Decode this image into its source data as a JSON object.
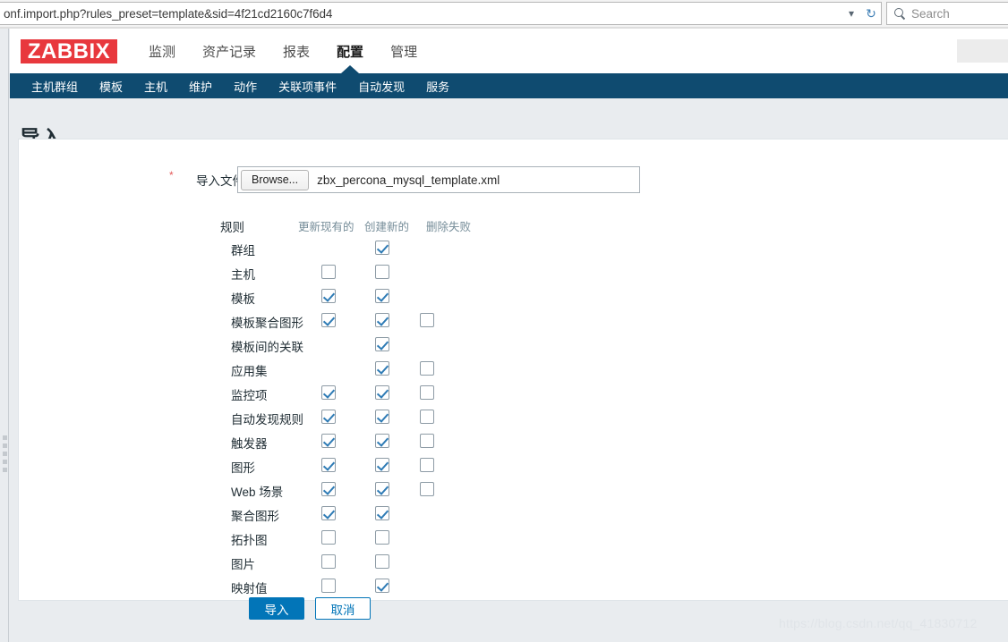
{
  "browser": {
    "url": "onf.import.php?rules_preset=template&sid=4f21cd2160c7f6d4",
    "dropdown_icon": "chevron-down-icon",
    "reload_icon": "reload-icon",
    "search_icon": "search-icon",
    "search_placeholder": "Search",
    "search_value": ""
  },
  "header": {
    "logo": "ZABBIX",
    "nav": [
      {
        "label": "监测",
        "active": false
      },
      {
        "label": "资产记录",
        "active": false
      },
      {
        "label": "报表",
        "active": false
      },
      {
        "label": "配置",
        "active": true
      },
      {
        "label": "管理",
        "active": false
      }
    ]
  },
  "subnav": {
    "items": [
      {
        "label": "主机群组"
      },
      {
        "label": "模板"
      },
      {
        "label": "主机"
      },
      {
        "label": "维护"
      },
      {
        "label": "动作"
      },
      {
        "label": "关联项事件"
      },
      {
        "label": "自动发现"
      },
      {
        "label": "服务"
      }
    ]
  },
  "page": {
    "title": "导入"
  },
  "form": {
    "file_label": "导入文件",
    "required_mark": "*",
    "browse_label": "Browse...",
    "file_name": "zbx_percona_mysql_template.xml",
    "rules_label": "规则",
    "column_headers": [
      "更新现有的",
      "创建新的",
      "删除失败"
    ],
    "rows": [
      {
        "name": "群组",
        "update_existing": null,
        "create_new": true,
        "delete_missing": null
      },
      {
        "name": "主机",
        "update_existing": false,
        "create_new": false,
        "delete_missing": null
      },
      {
        "name": "模板",
        "update_existing": true,
        "create_new": true,
        "delete_missing": null
      },
      {
        "name": "模板聚合图形",
        "update_existing": true,
        "create_new": true,
        "delete_missing": false
      },
      {
        "name": "模板间的关联",
        "update_existing": null,
        "create_new": true,
        "delete_missing": null
      },
      {
        "name": "应用集",
        "update_existing": null,
        "create_new": true,
        "delete_missing": false
      },
      {
        "name": "监控项",
        "update_existing": true,
        "create_new": true,
        "delete_missing": false
      },
      {
        "name": "自动发现规则",
        "update_existing": true,
        "create_new": true,
        "delete_missing": false
      },
      {
        "name": "触发器",
        "update_existing": true,
        "create_new": true,
        "delete_missing": false
      },
      {
        "name": "图形",
        "update_existing": true,
        "create_new": true,
        "delete_missing": false
      },
      {
        "name": "Web 场景",
        "update_existing": true,
        "create_new": true,
        "delete_missing": false
      },
      {
        "name": "聚合图形",
        "update_existing": true,
        "create_new": true,
        "delete_missing": null
      },
      {
        "name": "拓扑图",
        "update_existing": false,
        "create_new": false,
        "delete_missing": null
      },
      {
        "name": "图片",
        "update_existing": false,
        "create_new": false,
        "delete_missing": null
      },
      {
        "name": "映射值",
        "update_existing": false,
        "create_new": true,
        "delete_missing": null
      }
    ],
    "submit_label": "导入",
    "cancel_label": "取消"
  },
  "watermark": "https://blog.csdn.net/qq_41830712",
  "colors": {
    "logo_red": "#e8383d",
    "subnav_blue": "#0f4b70",
    "accent_blue": "#0275b8",
    "page_bg": "#e9ecef"
  }
}
